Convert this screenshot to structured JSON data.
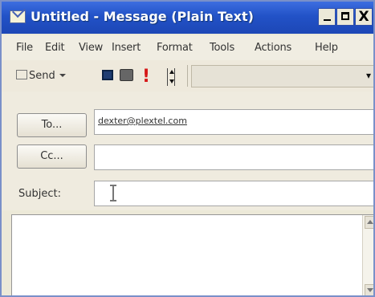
{
  "window": {
    "title": "Untitled - Message (Plain Text)",
    "close_symbol": "X"
  },
  "menu": {
    "items": [
      "File",
      "Edit",
      "View",
      "Insert",
      "Format",
      "Tools",
      "Actions",
      "Help"
    ]
  },
  "toolbar": {
    "send_label": "Send",
    "importance_symbol": "!"
  },
  "header": {
    "to_label": "To...",
    "to_value": "dexter@plextel.com",
    "cc_label": "Cc...",
    "cc_value": "",
    "subject_label": "Subject:",
    "subject_value": ""
  },
  "colors": {
    "titlebar": "#2252c7",
    "importance": "#d61818"
  }
}
